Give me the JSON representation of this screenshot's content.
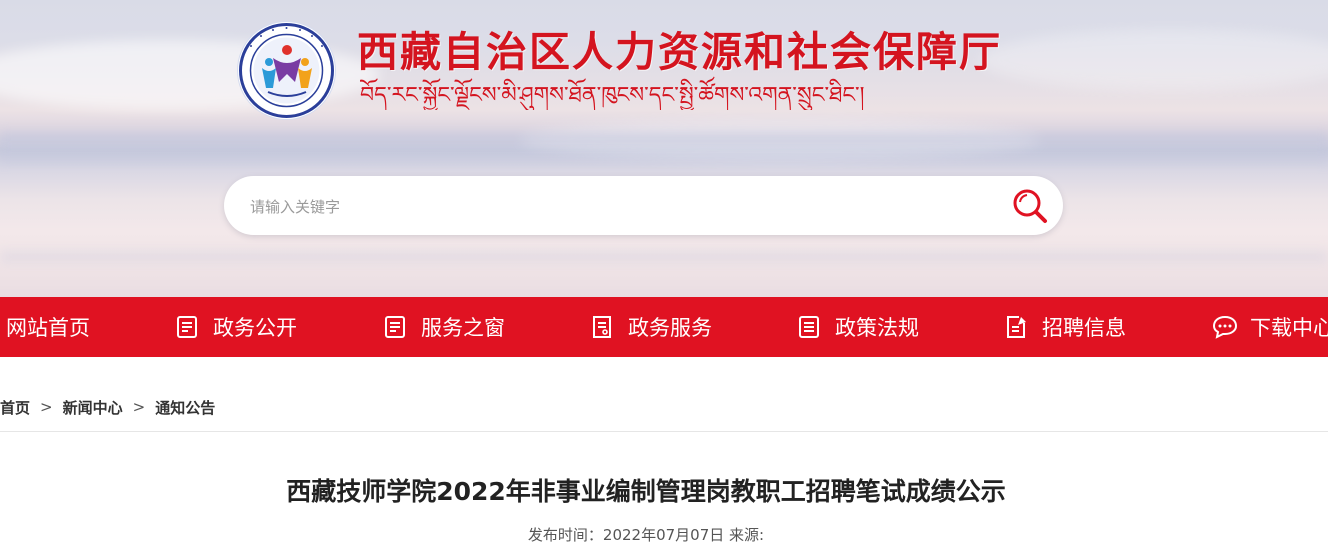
{
  "header": {
    "title_cn": "西藏自治区人力资源和社会保障厅",
    "title_tibetan": "བོད་རང་སྐྱོང་ལྗོངས་མི་ཤུགས་ཐོན་ཁུངས་དང་སྤྱི་ཚོགས་འགན་སྲུང་ཐིང་།",
    "logo_icon": "hrss-emblem-icon"
  },
  "search": {
    "placeholder": "请输入关键字",
    "value": "",
    "icon": "search-icon"
  },
  "nav": {
    "items": [
      {
        "label": "网站首页",
        "icon": ""
      },
      {
        "label": "政务公开",
        "icon": "document-list-icon"
      },
      {
        "label": "服务之窗",
        "icon": "document-list-icon"
      },
      {
        "label": "政务服务",
        "icon": "form-icon"
      },
      {
        "label": "政策法规",
        "icon": "document-list-icon"
      },
      {
        "label": "招聘信息",
        "icon": "edit-note-icon"
      },
      {
        "label": "下载中心",
        "icon": "chat-bubble-icon"
      }
    ]
  },
  "breadcrumb": {
    "items": [
      "首页",
      "新闻中心",
      "通知公告"
    ],
    "separator": ">"
  },
  "article": {
    "title": "西藏技师学院2022年非事业编制管理岗教职工招聘笔试成绩公示",
    "meta": "发布时间：2022年07月07日 来源:"
  },
  "colors": {
    "brand_red": "#e01222",
    "title_red": "#d4141f"
  }
}
